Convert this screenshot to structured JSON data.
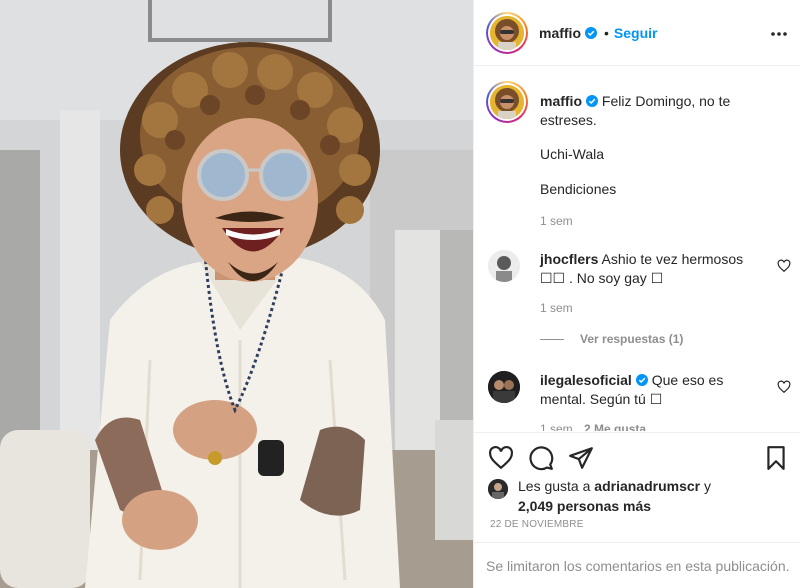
{
  "post": {
    "username": "maffio",
    "separator": "•",
    "follow_label": "Seguir",
    "more_icon": "more-options-icon",
    "verified_icon": "verified-badge-icon"
  },
  "caption": {
    "username": "maffio",
    "text_1": "Feliz Domingo, no te estreses.",
    "text_2": "Uchi-Wala",
    "text_3": "Bendiciones",
    "time": "1 sem"
  },
  "comments": [
    {
      "username": "jhocflers",
      "text": "Ashio te vez hermosos ☐☐ . No soy gay ☐",
      "time": "1 sem"
    },
    {
      "username": "ilegalesoficial",
      "text": "Que eso es mental. Según tú ☐",
      "time": "1 sem",
      "likes": "2 Me gusta"
    }
  ],
  "view_replies": "Ver respuestas (1)",
  "actions": {
    "like_icon": "heart-icon",
    "comment_icon": "comment-icon",
    "share_icon": "share-icon",
    "save_icon": "bookmark-icon"
  },
  "likes": {
    "prefix": "Les gusta a",
    "user": "adrianadrumscr",
    "joiner": "y",
    "count": "2,049 personas más"
  },
  "date": "22 DE NOVIEMBRE",
  "limited_notice": "Se limitaron los comentarios en esta publicación.",
  "colors": {
    "accent": "#0095f6",
    "secondary_text": "#8e8e8e",
    "border": "#efefef"
  }
}
